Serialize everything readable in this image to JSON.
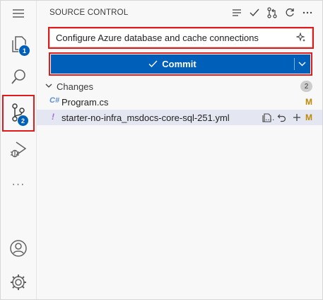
{
  "activity_bar": {
    "explorer_badge": "1",
    "scm_badge": "2",
    "more_label": "···"
  },
  "source_control": {
    "title": "SOURCE CONTROL",
    "commit_message": "Configure Azure database and cache connections",
    "commit_label": "Commit",
    "changes_label": "Changes",
    "changes_count": "2",
    "files": [
      {
        "name": "Program.cs",
        "icon": "C#",
        "status": "M"
      },
      {
        "name": "starter-no-infra_msdocs-core-sql-251.yml",
        "icon": "!",
        "status": "M",
        "ellipsis": "...."
      }
    ]
  },
  "colors": {
    "accent": "#005fb8",
    "highlight": "#e01b1b",
    "modified": "#bf8803",
    "csharp": "#5b8fd6",
    "yaml": "#a46ad6"
  }
}
